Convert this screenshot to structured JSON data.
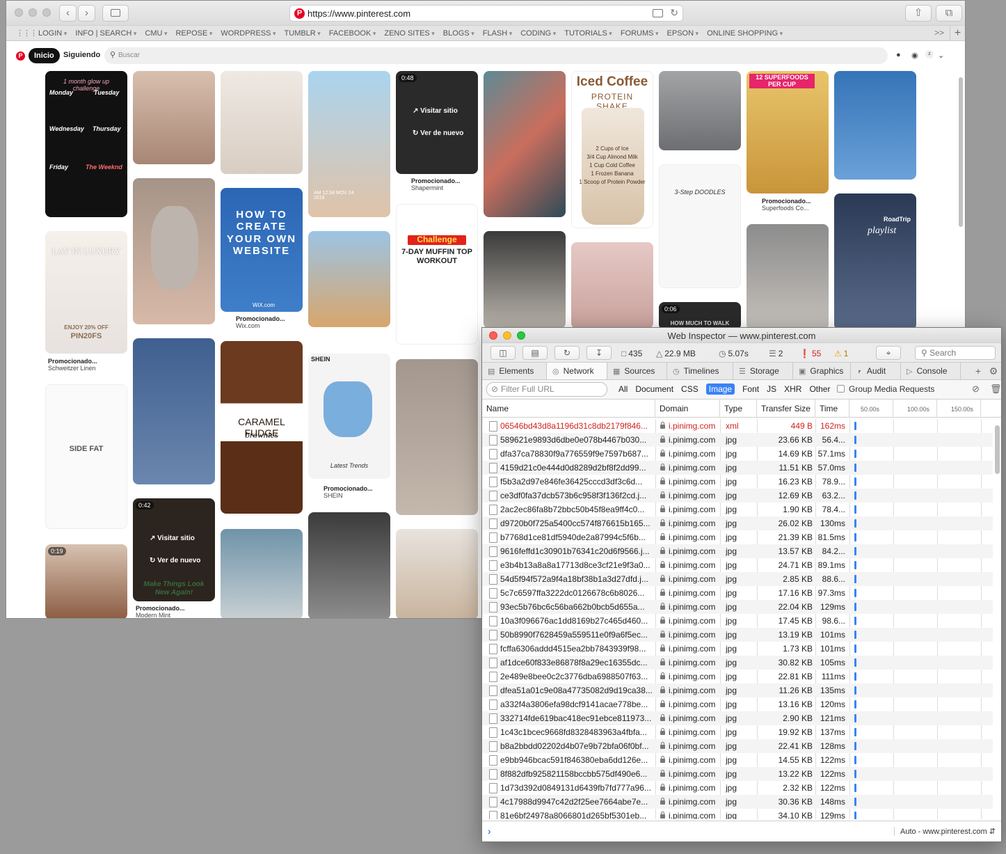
{
  "safari": {
    "url": "https://www.pinterest.com",
    "bookmarks": [
      "LOGIN",
      "INFO | SEARCH",
      "CMU",
      "REPOSE",
      "WORDPRESS",
      "TUMBLR",
      "FACEBOOK",
      "ZENO SITES",
      "BLOGS",
      "FLASH",
      "CODING",
      "TUTORIALS",
      "FORUMS",
      "EPSON",
      "ONLINE SHOPPING"
    ],
    "bookmarks_more": ">>"
  },
  "pinterest": {
    "home": "Inicio",
    "following": "Siguiendo",
    "search_placeholder": "Buscar",
    "visit_site": "Visitar sitio",
    "watch_again": "Ver de nuevo",
    "pins": {
      "p1_title": "1 month glow up challenge",
      "p1_mon": "Monday",
      "p1_tue": "Tuesday",
      "p1_wed": "Wednesday",
      "p1_thu": "Thursday",
      "p1_fri": "Friday",
      "p1_wkd": "The Weeknd",
      "p2_title": "LAY IN LUXURY",
      "p2_offer": "ENJOY 20% OFF",
      "p2_code": "PIN20FS",
      "p2_promo": "Promocionado...",
      "p2_who": "Schweitzer Linen",
      "p3_title": "SIDE FAT",
      "p4_dur": "0:19",
      "p5_dur": "0:42",
      "p5_promo": "Promocionado...",
      "p5_who": "Modern Mint",
      "p5_text": "Make Things Look New Again!",
      "p6_title": "HOW TO CREATE YOUR OWN WEBSITE",
      "p6_brand": "WiX.com",
      "p6_promo": "Promocionado...",
      "p6_who": "Wix.com",
      "p7_title": "CARAMEL FUDGE",
      "p7_sub": "brownies",
      "p8_date": "AM 12:34 MOV 24 2018",
      "p9_brand": "SHEIN",
      "p9_promo": "Promocionado...",
      "p9_who": "SHEIN",
      "p9_tag": "Latest Trends",
      "p10_dur": "0:48",
      "p10_promo": "Promocionado...",
      "p10_who": "Shapermint",
      "p11_title": "Challenge",
      "p11_sub": "7-DAY MUFFIN TOP WORKOUT",
      "p12_title": "Iced Coffee",
      "p12_sub": "PROTEIN SHAKE",
      "p12_r1": "2 Cups of Ice",
      "p12_r2": "3/4 Cup Almond Milk",
      "p12_r3": "1 Cup Cold Coffee",
      "p12_r4": "1 Frozen Banana",
      "p12_r5": "1 Scoop of Protein Powder",
      "p13_title": "3-Step DOODLES",
      "p14_dur": "0:06",
      "p14_text": "HOW MUCH TO WALK",
      "p15_title": "12 SUPERFOODS PER CUP",
      "p15_promo": "Promocionado...",
      "p15_who": "Superfoods Co...",
      "p16_title": "RoadTrip",
      "p16_sub": "playlist"
    }
  },
  "inspector": {
    "title": "Web Inspector — www.pinterest.com",
    "stats": {
      "resources": "435",
      "size": "22.9 MB",
      "time": "5.07s",
      "logs": "2",
      "errors": "55",
      "warnings": "1"
    },
    "search_placeholder": "Search",
    "tabs": [
      "Elements",
      "Network",
      "Sources",
      "Timelines",
      "Storage",
      "Graphics",
      "Audit",
      "Console"
    ],
    "filter_placeholder": "Filter Full URL",
    "types": [
      "All",
      "Document",
      "CSS",
      "Image",
      "Font",
      "JS",
      "XHR",
      "Other"
    ],
    "group_label": "Group Media Requests",
    "columns": {
      "name": "Name",
      "domain": "Domain",
      "type": "Type",
      "size": "Transfer Size",
      "time": "Time"
    },
    "ticks": [
      "50.00s",
      "100.00s",
      "150.00s"
    ],
    "context": "Auto - www.pinterest.com",
    "rows": [
      {
        "name": "06546bd43d8a1196d31c8db2179f846...",
        "domain": "i.pinimg.com",
        "type": "xml",
        "size": "449 B",
        "time": "162ms"
      },
      {
        "name": "589621e9893d6dbe0e078b4467b030...",
        "domain": "i.pinimg.com",
        "type": "jpg",
        "size": "23.66 KB",
        "time": "56.4..."
      },
      {
        "name": "dfa37ca78830f9a776559f9e7597b687...",
        "domain": "i.pinimg.com",
        "type": "jpg",
        "size": "14.69 KB",
        "time": "57.1ms"
      },
      {
        "name": "4159d21c0e444d0d8289d2bf8f2dd99...",
        "domain": "i.pinimg.com",
        "type": "jpg",
        "size": "11.51 KB",
        "time": "57.0ms"
      },
      {
        "name": "f5b3a2d97e846fe36425cccd3df3c6d...",
        "domain": "i.pinimg.com",
        "type": "jpg",
        "size": "16.23 KB",
        "time": "78.9..."
      },
      {
        "name": "ce3df0fa37dcb573b6c958f3f136f2cd.j...",
        "domain": "i.pinimg.com",
        "type": "jpg",
        "size": "12.69 KB",
        "time": "63.2..."
      },
      {
        "name": "2ac2ec86fa8b72bbc50b45f8ea9ff4c0...",
        "domain": "i.pinimg.com",
        "type": "jpg",
        "size": "1.90 KB",
        "time": "78.4..."
      },
      {
        "name": "d9720b0f725a5400cc574f876615b165...",
        "domain": "i.pinimg.com",
        "type": "jpg",
        "size": "26.02 KB",
        "time": "130ms"
      },
      {
        "name": "b7768d1ce81df5940de2a87994c5f6b...",
        "domain": "i.pinimg.com",
        "type": "jpg",
        "size": "21.39 KB",
        "time": "81.5ms"
      },
      {
        "name": "9616feffd1c30901b76341c20d6f9566.j...",
        "domain": "i.pinimg.com",
        "type": "jpg",
        "size": "13.57 KB",
        "time": "84.2..."
      },
      {
        "name": "e3b4b13a8a8a17713d8ce3cf21e9f3a0...",
        "domain": "i.pinimg.com",
        "type": "jpg",
        "size": "24.71 KB",
        "time": "89.1ms"
      },
      {
        "name": "54d5f94f572a9f4a18bf38b1a3d27dfd.j...",
        "domain": "i.pinimg.com",
        "type": "jpg",
        "size": "2.85 KB",
        "time": "88.6..."
      },
      {
        "name": "5c7c6597ffa3222dc0126678c6b8026...",
        "domain": "i.pinimg.com",
        "type": "jpg",
        "size": "17.16 KB",
        "time": "97.3ms"
      },
      {
        "name": "93ec5b76bc6c56ba662b0bcb5d655a...",
        "domain": "i.pinimg.com",
        "type": "jpg",
        "size": "22.04 KB",
        "time": "129ms"
      },
      {
        "name": "10a3f096676ac1dd8169b27c465d460...",
        "domain": "i.pinimg.com",
        "type": "jpg",
        "size": "17.45 KB",
        "time": "98.6..."
      },
      {
        "name": "50b8990f7628459a559511e0f9a6f5ec...",
        "domain": "i.pinimg.com",
        "type": "jpg",
        "size": "13.19 KB",
        "time": "101ms"
      },
      {
        "name": "fcffa6306addd4515ea2bb7843939f98...",
        "domain": "i.pinimg.com",
        "type": "jpg",
        "size": "1.73 KB",
        "time": "101ms"
      },
      {
        "name": "af1dce60f833e86878f8a29ec16355dc...",
        "domain": "i.pinimg.com",
        "type": "jpg",
        "size": "30.82 KB",
        "time": "105ms"
      },
      {
        "name": "2e489e8bee0c2c3776dba6988507f63...",
        "domain": "i.pinimg.com",
        "type": "jpg",
        "size": "22.81 KB",
        "time": "111ms"
      },
      {
        "name": "dfea51a01c9e08a47735082d9d19ca38...",
        "domain": "i.pinimg.com",
        "type": "jpg",
        "size": "11.26 KB",
        "time": "135ms"
      },
      {
        "name": "a332f4a3806efa98dcf9141acae778be...",
        "domain": "i.pinimg.com",
        "type": "jpg",
        "size": "13.16 KB",
        "time": "120ms"
      },
      {
        "name": "332714fde619bac418ec91ebce811973...",
        "domain": "i.pinimg.com",
        "type": "jpg",
        "size": "2.90 KB",
        "time": "121ms"
      },
      {
        "name": "1c43c1bcec9668fd8328483963a4fbfa...",
        "domain": "i.pinimg.com",
        "type": "jpg",
        "size": "19.92 KB",
        "time": "137ms"
      },
      {
        "name": "b8a2bbdd02202d4b07e9b72bfa06f0bf...",
        "domain": "i.pinimg.com",
        "type": "jpg",
        "size": "22.41 KB",
        "time": "128ms"
      },
      {
        "name": "e9bb946bcac591f846380eba6dd126e...",
        "domain": "i.pinimg.com",
        "type": "jpg",
        "size": "14.55 KB",
        "time": "122ms"
      },
      {
        "name": "8f882dfb925821158bccbb575df490e6...",
        "domain": "i.pinimg.com",
        "type": "jpg",
        "size": "13.22 KB",
        "time": "122ms"
      },
      {
        "name": "1d73d392d0849131d6439fb7fd777a96...",
        "domain": "i.pinimg.com",
        "type": "jpg",
        "size": "2.32 KB",
        "time": "122ms"
      },
      {
        "name": "4c17988d9947c42d2f25ee7664abe7e...",
        "domain": "i.pinimg.com",
        "type": "jpg",
        "size": "30.36 KB",
        "time": "148ms"
      },
      {
        "name": "81e6bf24978a8066801d265bf5301eb...",
        "domain": "i.pinimg.com",
        "type": "jpg",
        "size": "34.10 KB",
        "time": "129ms"
      }
    ]
  }
}
